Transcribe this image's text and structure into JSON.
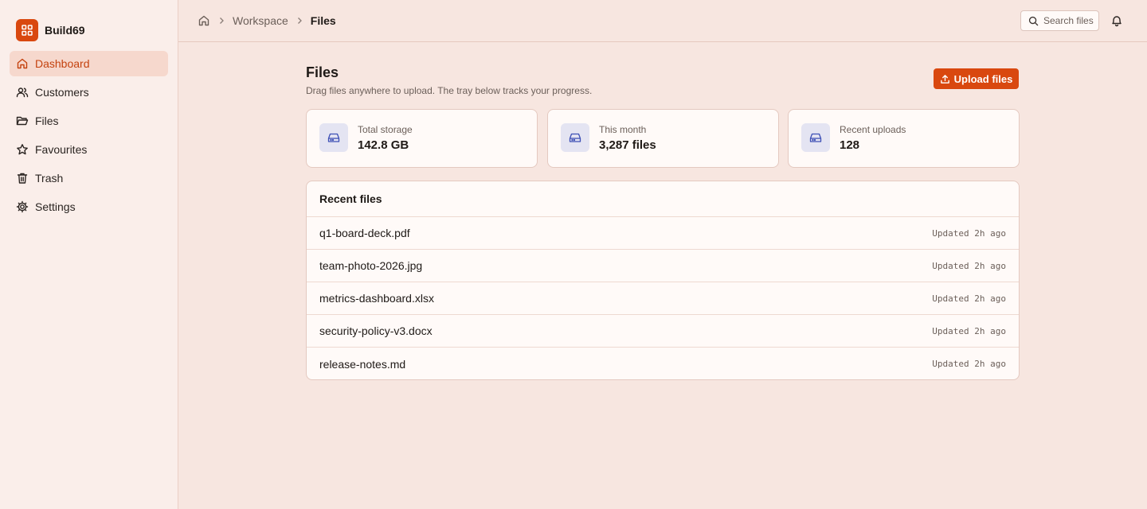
{
  "brand": {
    "name": "Build69",
    "accent": "#d9480f"
  },
  "sidebar": {
    "items": [
      {
        "label": "Dashboard",
        "icon": "home-icon",
        "active": true
      },
      {
        "label": "Customers",
        "icon": "users-icon",
        "active": false
      },
      {
        "label": "Files",
        "icon": "folder-icon",
        "active": false
      },
      {
        "label": "Favourites",
        "icon": "star-icon",
        "active": false
      },
      {
        "label": "Trash",
        "icon": "trash-icon",
        "active": false
      },
      {
        "label": "Settings",
        "icon": "gear-icon",
        "active": false
      }
    ]
  },
  "topbar": {
    "breadcrumb": {
      "home_icon": "home-icon",
      "items": [
        "Workspace",
        "Files"
      ]
    },
    "search": {
      "placeholder": "Search files",
      "icon": "search-icon"
    },
    "notifications_icon": "bell-icon"
  },
  "header": {
    "title": "Files",
    "subtitle": "Drag files anywhere to upload. The tray below tracks your progress.",
    "upload_label": "Upload files",
    "upload_icon": "upload-icon"
  },
  "stats": [
    {
      "label": "Total storage",
      "value": "142.8 GB",
      "icon": "hard-drive-icon"
    },
    {
      "label": "This month",
      "value": "3,287 files",
      "icon": "hard-drive-icon"
    },
    {
      "label": "Recent uploads",
      "value": "128",
      "icon": "hard-drive-icon"
    }
  ],
  "recent": {
    "title": "Recent files",
    "files": [
      {
        "name": "q1-board-deck.pdf",
        "meta": "Updated 2h ago"
      },
      {
        "name": "team-photo-2026.jpg",
        "meta": "Updated 2h ago"
      },
      {
        "name": "metrics-dashboard.xlsx",
        "meta": "Updated 2h ago"
      },
      {
        "name": "security-policy-v3.docx",
        "meta": "Updated 2h ago"
      },
      {
        "name": "release-notes.md",
        "meta": "Updated 2h ago"
      }
    ]
  }
}
